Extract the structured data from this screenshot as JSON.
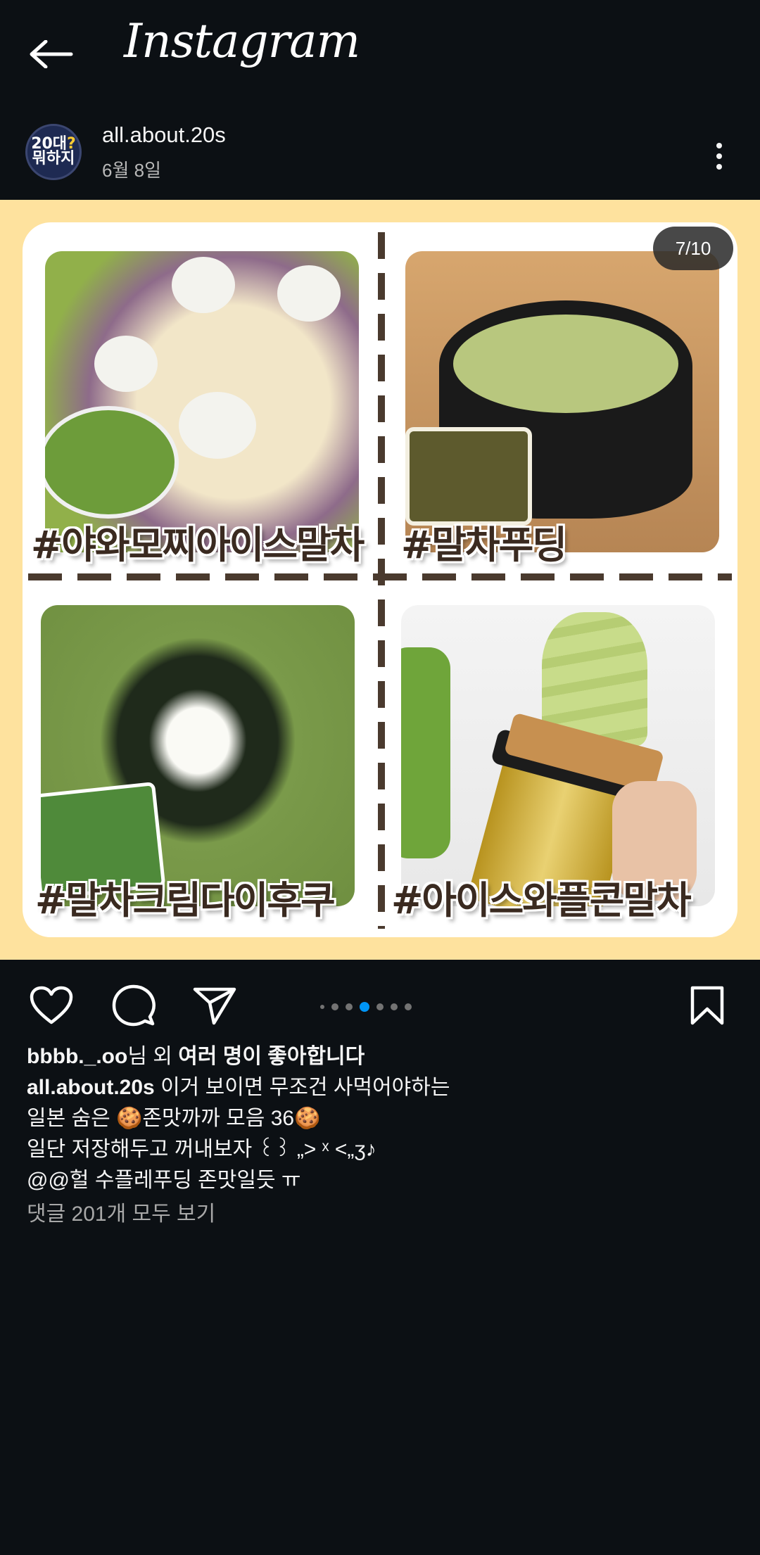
{
  "app": {
    "title": "Instagram"
  },
  "post": {
    "username": "all.about.20s",
    "date": "6월 8일",
    "avatar": {
      "line1": "20대",
      "line1_q": "?",
      "line2": "뭐하지"
    }
  },
  "media": {
    "counter": "7/10",
    "hashtags": [
      "#야와모찌아이스말차",
      "#말차푸딩",
      "#말차크림다이후쿠",
      "#아이스와플콘말차"
    ],
    "current_index": 7,
    "total": 10
  },
  "actions": {
    "like": "heart-icon",
    "comment": "comment-icon",
    "share": "send-icon",
    "save": "bookmark-icon"
  },
  "likes": {
    "user": "bbbb._.oo",
    "suffix_normal": "님 외 ",
    "suffix_bold": "여러 명이 좋아합니다"
  },
  "caption": {
    "user": "all.about.20s",
    "line1": " 이거 보이면 무조건 사먹어야하는",
    "line2": "일본 숨은 🍪존맛까까 모음 36🍪",
    "line3": "일단 저장해두고 꺼내보자 ꒰꒱ „> ˣ <„ʒ♪",
    "line4": "@@헐 수플레푸딩 존맛일듯 ㅠ"
  },
  "comments": {
    "view_all": "댓글 201개 모두 보기"
  },
  "colors": {
    "bg": "#0c1014",
    "media_bg": "#fee29e",
    "accent_dot": "#0095f6",
    "hashtag": "#3a2a20"
  }
}
